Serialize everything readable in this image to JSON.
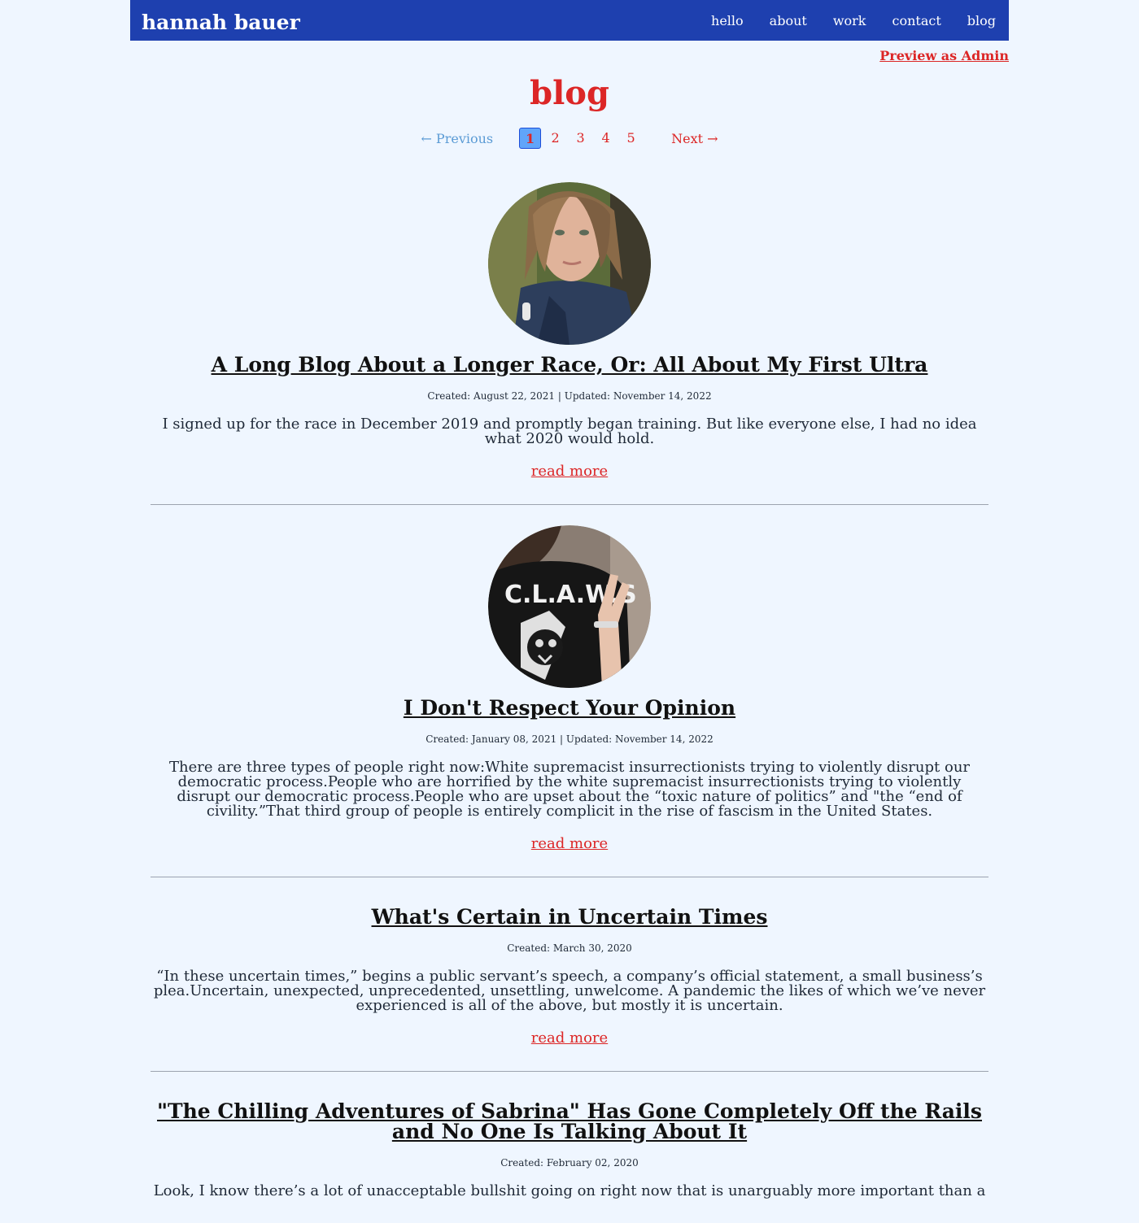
{
  "site": {
    "brand": "hannah bauer",
    "nav": [
      "hello",
      "about",
      "work",
      "contact",
      "blog"
    ],
    "admin_link": "Preview as Admin"
  },
  "page": {
    "title": "blog"
  },
  "pagination": {
    "previous": "← Previous",
    "pages": [
      "1",
      "2",
      "3",
      "4",
      "5"
    ],
    "current": "1",
    "next": "Next →"
  },
  "posts": [
    {
      "title": "A Long Blog About a Longer Race, Or: All About My First Ultra",
      "meta": "Created: August 22, 2021 | Updated: November 14, 2022",
      "excerpt": "I signed up for the race in December 2019 and promptly began training. But like everyone else, I had no idea what 2020 would hold.",
      "read_more": "read more",
      "image": "selfie-photo",
      "image_text": ""
    },
    {
      "title": "I Don't Respect Your Opinion",
      "meta": "Created: January 08, 2021 | Updated: November 14, 2022",
      "excerpt": "There are three types of people right now:White supremacist insurrectionists trying to violently disrupt our democratic process.People who are horrified by the white supremacist insurrectionists trying to violently disrupt our democratic process.People who are upset about the “toxic nature of politics” and \"the “end of civility.”That third group of people is entirely complicit in the rise of fascism in the United States.",
      "read_more": "read more",
      "image": "claws-shirt-photo",
      "image_text": "C.L.A.W.S"
    },
    {
      "title": "What's Certain in Uncertain Times",
      "meta": "Created: March 30, 2020",
      "excerpt": "“In these uncertain times,” begins a public servant’s speech, a company’s official statement, a small business’s plea.Uncertain, unexpected, unprecedented, unsettling, unwelcome. A pandemic the likes of which we’ve never experienced is all of the above, but mostly it is uncertain.",
      "read_more": "read more"
    },
    {
      "title": "\"The Chilling Adventures of Sabrina\" Has Gone Completely Off the Rails and No One Is Talking About It",
      "meta": "Created: February 02, 2020",
      "excerpt": "Look, I know there’s a lot of unacceptable bullshit going on right now that is unarguably more important than a"
    }
  ],
  "colors": {
    "background": "#eff6ff",
    "header": "#1e40af",
    "accent": "#dc2626",
    "pagination_active": "#60a5fa",
    "pagination_prev": "#5b9bd5"
  }
}
